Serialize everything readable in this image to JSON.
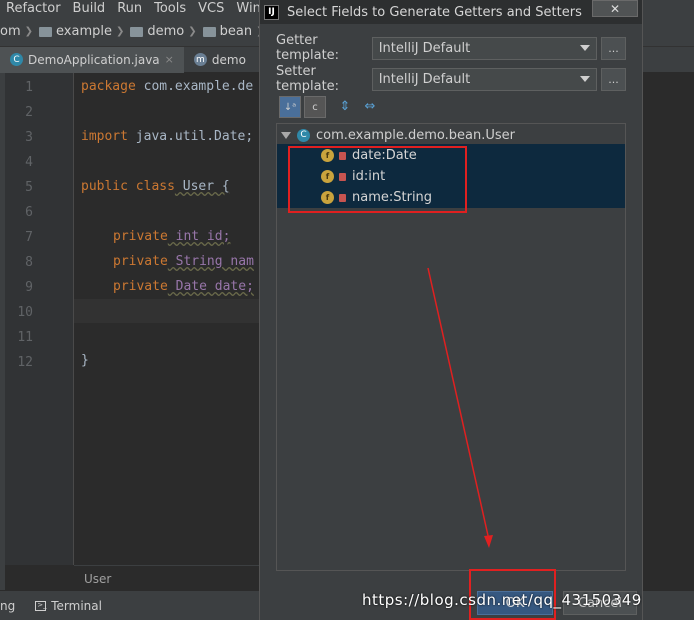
{
  "menubar": {
    "items": [
      "Refactor",
      "Build",
      "Run",
      "Tools",
      "VCS",
      "Windo"
    ]
  },
  "navbar": {
    "crumbs": [
      "om",
      "example",
      "demo",
      "bean"
    ],
    "class_icon": "C"
  },
  "tabs": [
    {
      "label": "DemoApplication.java",
      "close": "×"
    },
    {
      "label": "demo",
      "close": "×"
    }
  ],
  "editor": {
    "line_numbers": [
      "1",
      "2",
      "3",
      "4",
      "5",
      "6",
      "7",
      "8",
      "9",
      "10",
      "11",
      "12"
    ],
    "lines": [
      {
        "kw": "package",
        "rest": " com.example.de"
      },
      {
        "kw": "",
        "rest": ""
      },
      {
        "kw": "import",
        "rest": " java.util.Date;"
      },
      {
        "kw": "",
        "rest": ""
      },
      {
        "kw": "public class",
        "rest": " User {"
      },
      {
        "kw": "",
        "rest": ""
      },
      {
        "kw": "private",
        "rest": " int id;"
      },
      {
        "kw": "private",
        "rest": " String nam"
      },
      {
        "kw": "private",
        "rest": " Date date;"
      },
      {
        "kw": "",
        "rest": ""
      },
      {
        "kw": "",
        "rest": ""
      },
      {
        "kw": "",
        "rest": "}"
      }
    ],
    "status_label": "User"
  },
  "bottombar": {
    "left_text": "ng",
    "terminal_label": "Terminal"
  },
  "dialog": {
    "title": "Select Fields to Generate Getters and Setters",
    "logo": "IJ",
    "close_label": "✕",
    "getter_label": "Getter template:",
    "getter_value": "IntelliJ Default",
    "setter_label": "Setter template:",
    "setter_value": "IntelliJ Default",
    "dots_label": "...",
    "tree": {
      "root": "com.example.demo.bean.User",
      "root_icon": "C",
      "fields": [
        "date:Date",
        "id:int",
        "name:String"
      ],
      "field_icon": "f"
    },
    "ok_label": "OK",
    "cancel_label": "Cancel"
  },
  "watermark": "https://blog.csdn.net/qq_43150349",
  "colors": {
    "selection": "#0d293e",
    "annotation": "#e02020",
    "ok_button": "#365880"
  }
}
